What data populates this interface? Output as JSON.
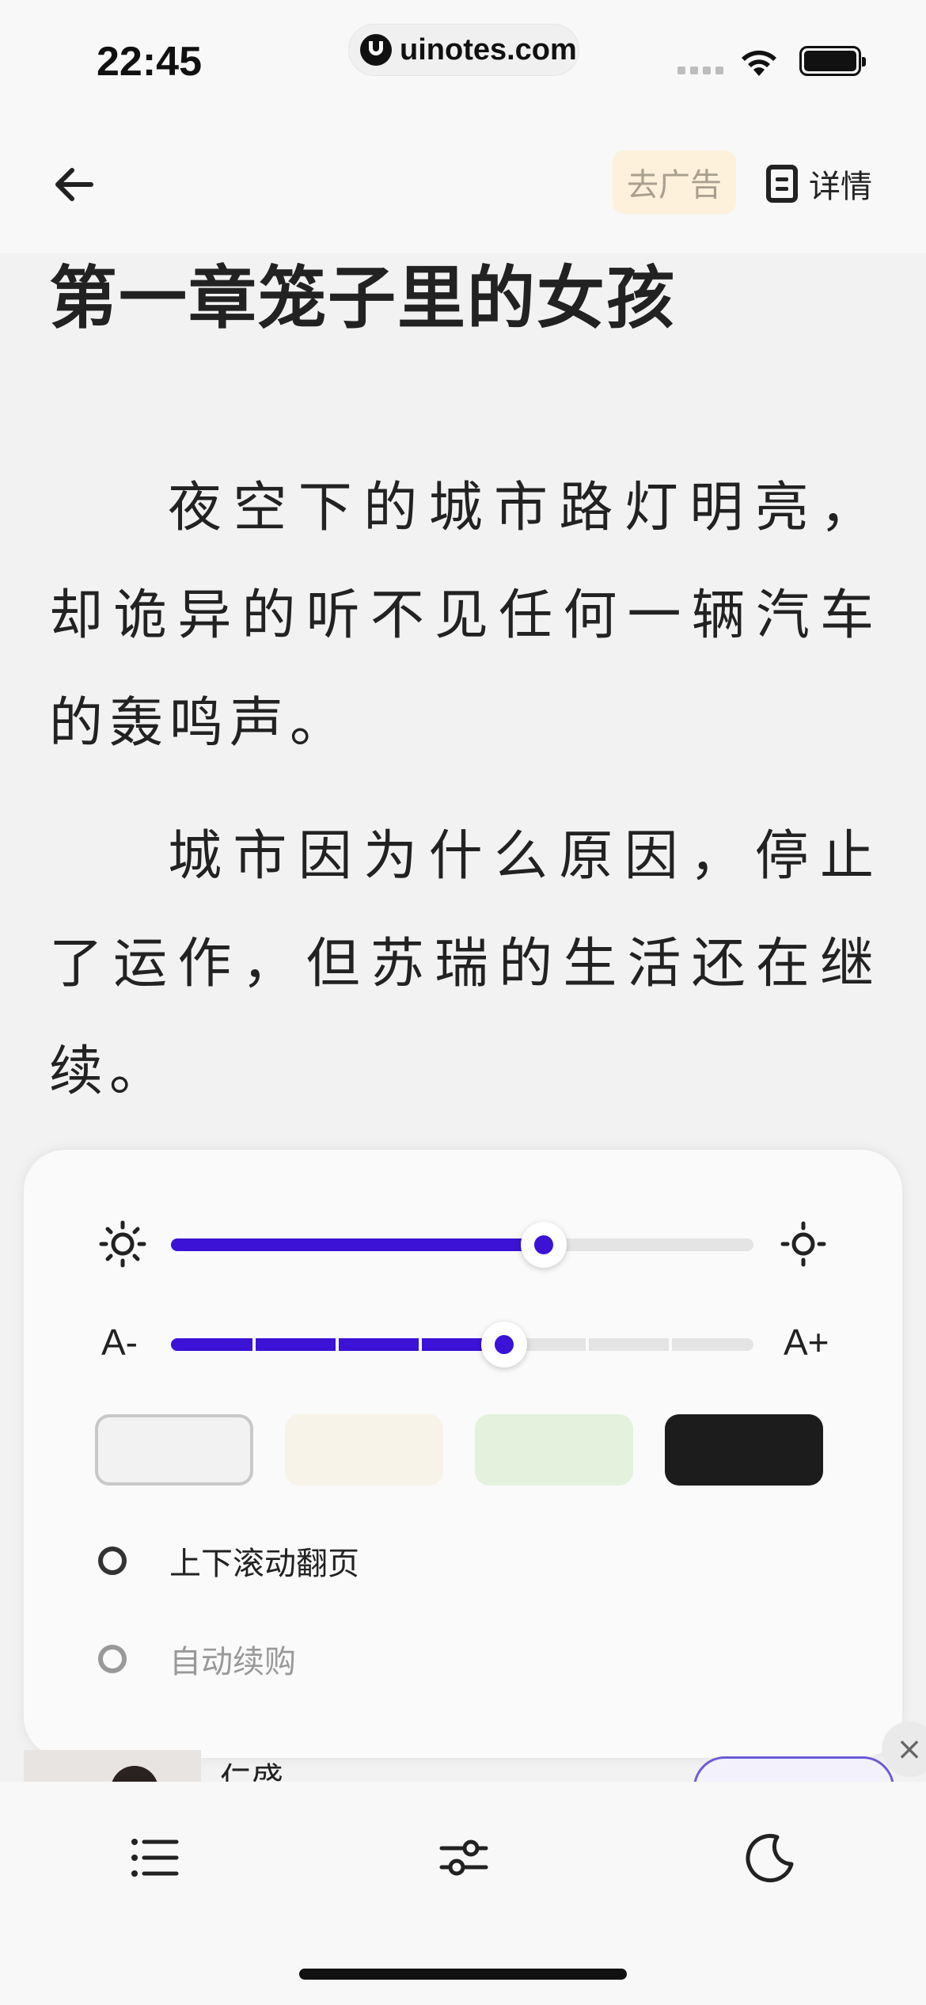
{
  "status_bar": {
    "time": "22:45",
    "url": "uinotes.com"
  },
  "header": {
    "remove_ads_label": "去广告",
    "details_label": "详情"
  },
  "content": {
    "chapter_title": "第一章笼子里的女孩",
    "paragraphs": [
      "夜空下的城市路灯明亮，却诡异的听不见任何一辆汽车的轰鸣声。",
      "城市因为什么原因，停止了运作，但苏瑞的生活还在继续。"
    ]
  },
  "settings_panel": {
    "brightness": {
      "value_fraction": 0.64,
      "icon_low": "sun-icon",
      "icon_high": "sun-outline-icon"
    },
    "font_size": {
      "label_decrease": "A-",
      "label_increase": "A+",
      "steps": 7,
      "current_step": 4
    },
    "themes": [
      {
        "name": "gray",
        "color": "#f2f2f2",
        "selected": true
      },
      {
        "name": "cream",
        "color": "#f7f3e8",
        "selected": false
      },
      {
        "name": "green",
        "color": "#e3f1dd",
        "selected": false
      },
      {
        "name": "dark",
        "color": "#1c1c1c",
        "selected": false
      }
    ],
    "options": {
      "vertical_scroll_label": "上下滚动翻页",
      "auto_purchase_label": "自动续购"
    },
    "accent_color": "#3b12d6"
  },
  "ad": {
    "text": "仁盛"
  },
  "bottom_nav": {
    "icons": [
      "menu-list-icon",
      "settings-sliders-icon",
      "moon-icon"
    ]
  }
}
